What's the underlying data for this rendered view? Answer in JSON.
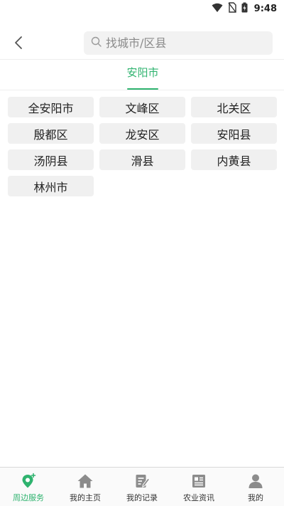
{
  "status_bar": {
    "time": "9:48",
    "icons": [
      "wifi-icon",
      "no-sim-icon",
      "battery-charging-icon"
    ]
  },
  "header": {
    "back_icon": "chevron-left-icon",
    "search": {
      "icon": "search-icon",
      "placeholder": "找城市/区县",
      "value": ""
    }
  },
  "tabs": [
    {
      "label": "安阳市",
      "active": true
    }
  ],
  "districts": [
    "全安阳市",
    "文峰区",
    "北关区",
    "殷都区",
    "龙安区",
    "安阳县",
    "汤阴县",
    "滑县",
    "内黄县",
    "林州市"
  ],
  "bottom_nav": [
    {
      "label": "周边服务",
      "icon": "location-pin-icon",
      "active": true
    },
    {
      "label": "我的主页",
      "icon": "home-icon",
      "active": false
    },
    {
      "label": "我的记录",
      "icon": "edit-note-icon",
      "active": false
    },
    {
      "label": "农业资讯",
      "icon": "newspaper-icon",
      "active": false
    },
    {
      "label": "我的",
      "icon": "person-icon",
      "active": false
    }
  ],
  "colors": {
    "accent": "#2fb36f",
    "cell_bg": "#f0f0f0",
    "search_bg": "#f2f2f2",
    "icon_gray": "#8c8c8c"
  }
}
